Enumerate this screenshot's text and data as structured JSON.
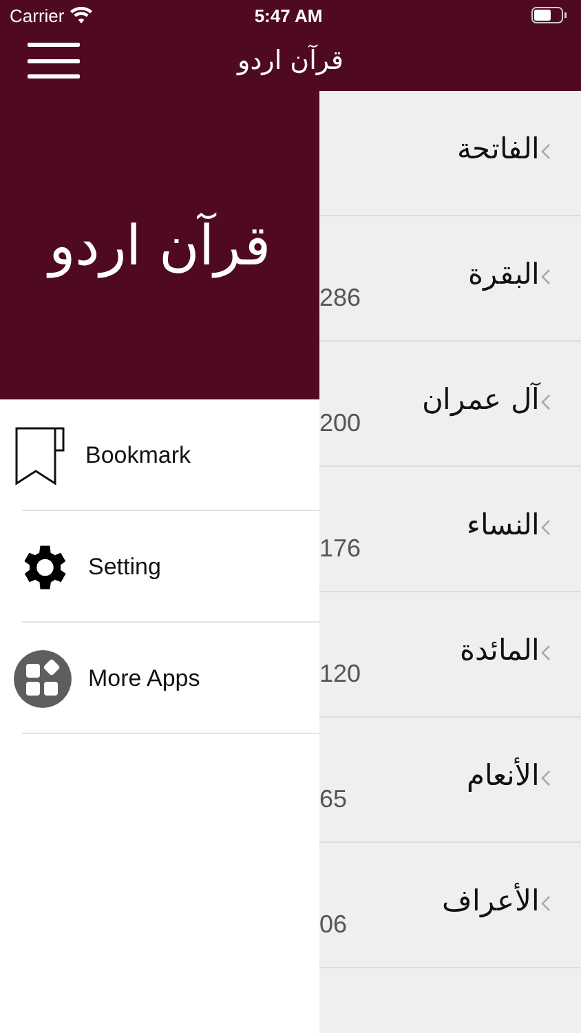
{
  "status_bar": {
    "carrier": "Carrier",
    "time": "5:47 AM"
  },
  "nav_bar": {
    "title": "قرآن اردو"
  },
  "drawer": {
    "header_title": "قرآن اردو",
    "items": [
      {
        "label": "Bookmark",
        "kind": "bookmark"
      },
      {
        "label": "Setting",
        "kind": "settings"
      },
      {
        "label": "More Apps",
        "kind": "apps"
      }
    ]
  },
  "surahs": [
    {
      "name": "الفاتحة"
    },
    {
      "name": "البقرة",
      "count": "286"
    },
    {
      "name": "آل عمران",
      "count": "200"
    },
    {
      "name": "النساء",
      "count": "176"
    },
    {
      "name": "المائدة",
      "count": "120"
    },
    {
      "name": "الأنعام",
      "count": "65"
    },
    {
      "name": "الأعراف",
      "count": "06"
    }
  ]
}
